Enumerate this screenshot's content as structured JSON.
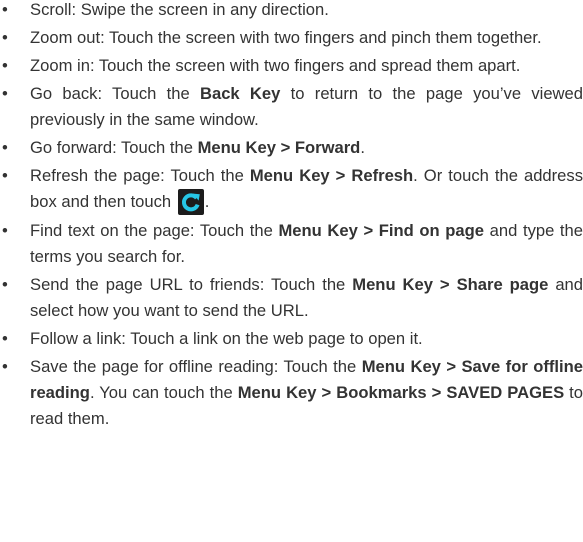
{
  "bullet_char": "•",
  "icons": {
    "refresh": "refresh-icon"
  },
  "colors": {
    "text": "#333333",
    "icon_bg": "#1c1c1c",
    "icon_fg": "#26c6e6"
  },
  "items": [
    {
      "t0": "Scroll: Swipe the screen in any direction."
    },
    {
      "t0": "Zoom out: Touch the screen with two fingers and pinch them together."
    },
    {
      "t0": "Zoom in: Touch the screen with two fingers and spread them apart."
    },
    {
      "t0": "Go back: Touch the ",
      "b0": "Back Key",
      "t1": " to return to the page you’ve viewed previously in the same window."
    },
    {
      "t0": "Go forward: Touch the ",
      "b0": "Menu Key > Forward",
      "t1": "."
    },
    {
      "t0": "Refresh the page: Touch the ",
      "b0": "Menu Key > Refresh",
      "t1": ". Or touch the address box and then touch ",
      "t2": "."
    },
    {
      "t0": "Find text on the page: Touch the ",
      "b0": "Menu Key > Find on page",
      "t1": " and type the terms you search for."
    },
    {
      "t0": "Send the page URL to friends: Touch the ",
      "b0": "Menu Key > Share page",
      "t1": " and select how you want to send the URL."
    },
    {
      "t0": "Follow a link: Touch a link on the web page to open it."
    },
    {
      "t0": "Save the page for offline reading: Touch the ",
      "b0": "Menu Key > Save for offline reading",
      "t1": ". You can touch the ",
      "b1": "Menu Key > Bookmarks > SAVED PAGES",
      "t2": " to read them."
    }
  ]
}
